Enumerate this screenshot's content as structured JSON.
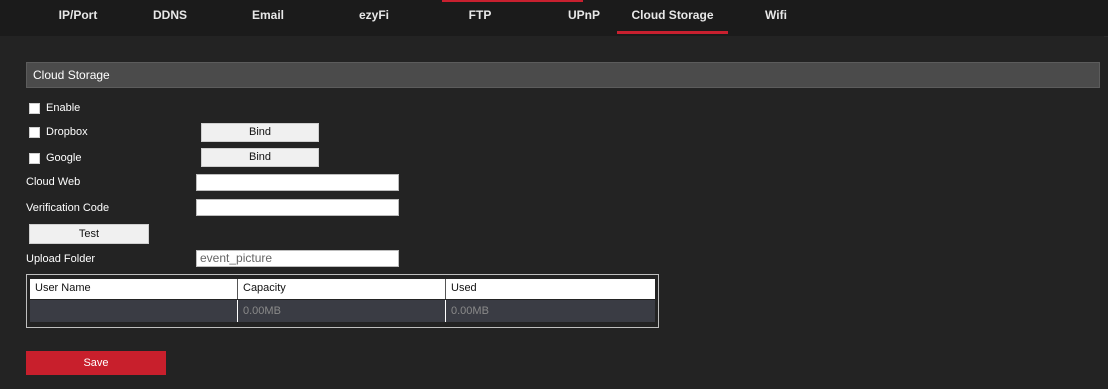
{
  "tabs": [
    "IP/Port",
    "DDNS",
    "Email",
    "ezyFi",
    "FTP",
    "UPnP",
    "Cloud Storage",
    "Wifi"
  ],
  "active_tab": "Cloud Storage",
  "accent_color": "#c8202f",
  "section": {
    "title": "Cloud Storage"
  },
  "enable": {
    "label": "Enable",
    "checked": false
  },
  "dropbox": {
    "label": "Dropbox",
    "checked": false,
    "bind_label": "Bind"
  },
  "google": {
    "label": "Google",
    "checked": false,
    "bind_label": "Bind"
  },
  "cloud_web": {
    "label": "Cloud Web",
    "value": ""
  },
  "verification_code": {
    "label": "Verification Code",
    "value": ""
  },
  "test_label": "Test",
  "upload_folder": {
    "label": "Upload Folder",
    "value": "event_picture"
  },
  "table": {
    "headers": [
      "User Name",
      "Capacity",
      "Used"
    ],
    "row": [
      "",
      "0.00MB",
      "0.00MB"
    ]
  },
  "save_label": "Save"
}
